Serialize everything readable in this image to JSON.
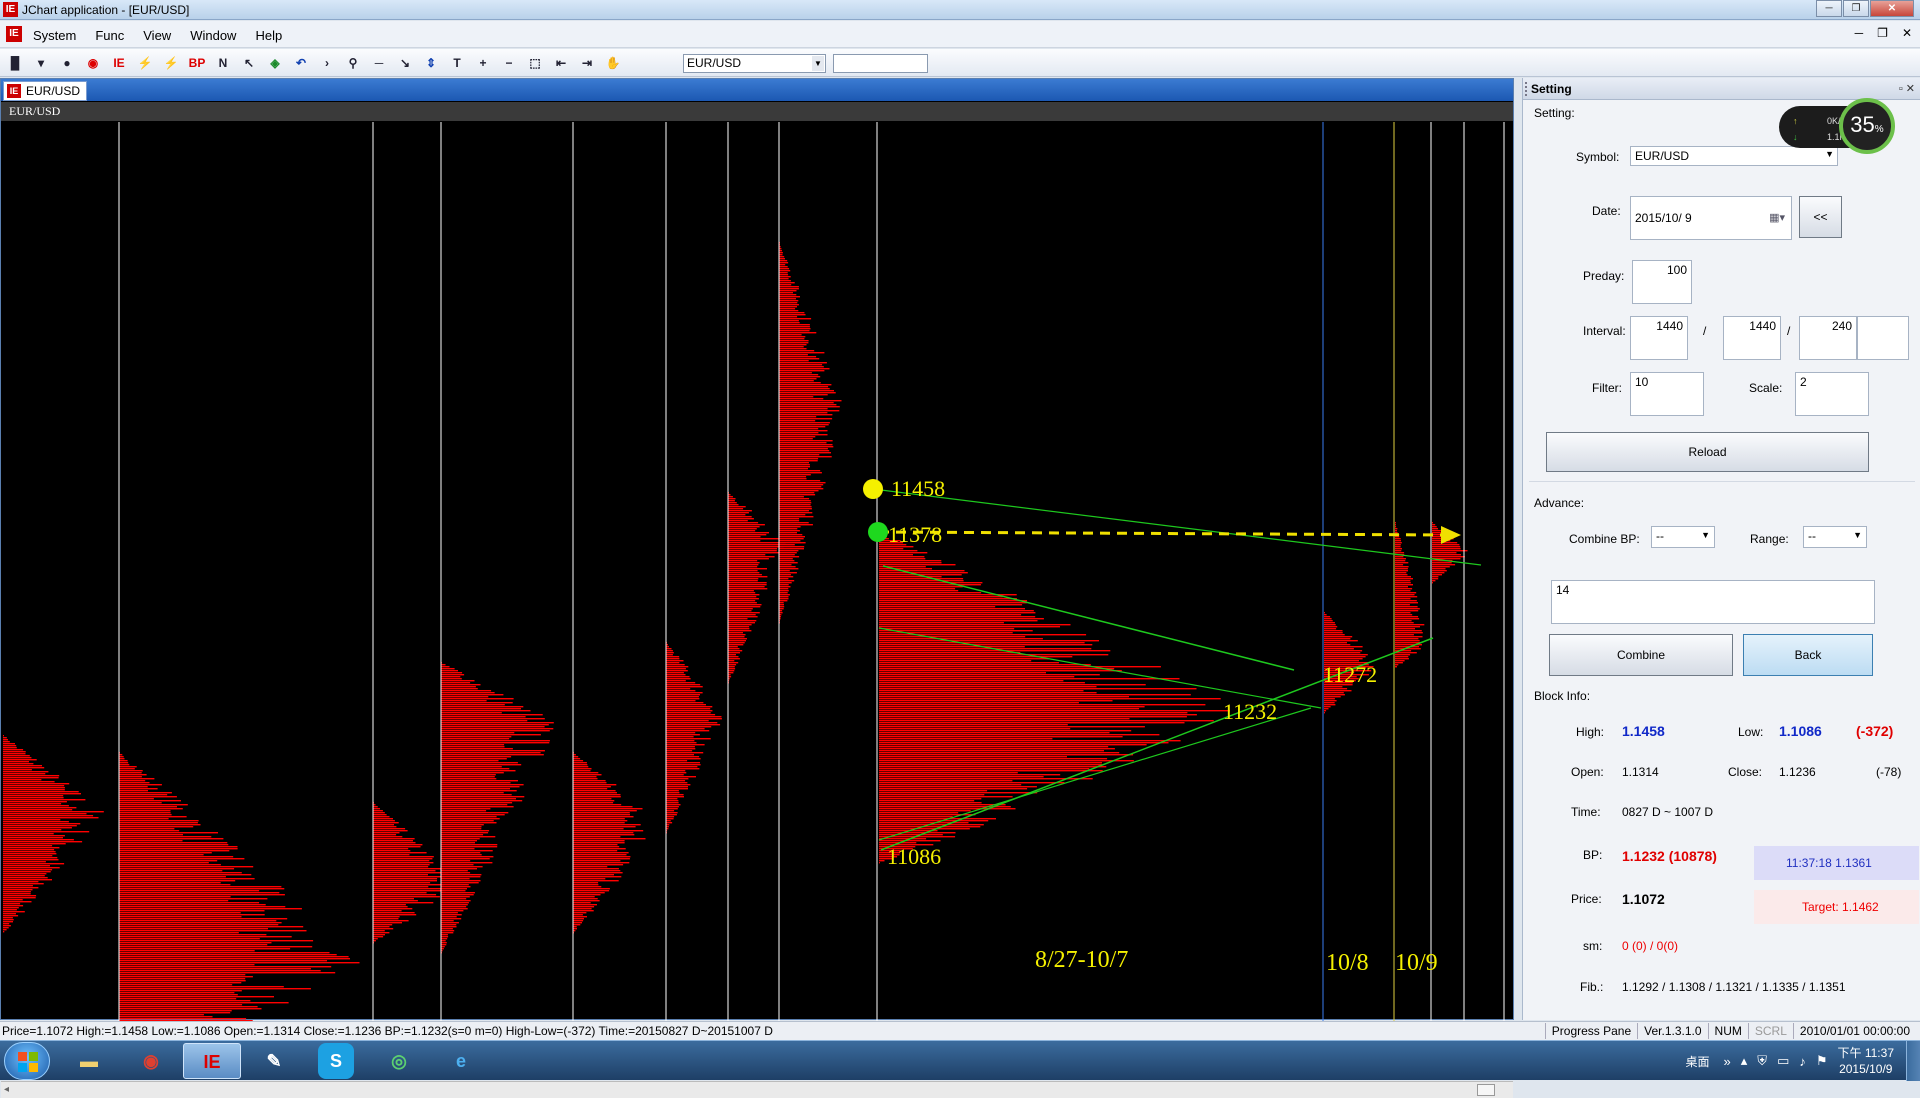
{
  "window": {
    "title": "JChart application - [EUR/USD]"
  },
  "menu": [
    "System",
    "Func",
    "View",
    "Window",
    "Help"
  ],
  "toolbar": {
    "symbol": "EUR/USD",
    "tools": [
      {
        "glyph": "▐▌",
        "name": "bar-chart-icon",
        "cls": ""
      },
      {
        "glyph": "▾",
        "name": "dropdown-arrow-icon",
        "cls": ""
      },
      {
        "glyph": "●",
        "name": "record-icon",
        "cls": ""
      },
      {
        "glyph": "◉",
        "name": "stop-icon",
        "cls": "red"
      },
      {
        "glyph": "IE",
        "name": "app-logo-icon",
        "cls": "red"
      },
      {
        "glyph": "⚡",
        "name": "lightning-yellow-icon",
        "cls": ""
      },
      {
        "glyph": "⚡",
        "name": "lightning-red-icon",
        "cls": "red"
      },
      {
        "glyph": "BP",
        "name": "bp-icon",
        "cls": "red"
      },
      {
        "glyph": "N",
        "name": "n-tool-icon",
        "cls": ""
      },
      {
        "glyph": "↖",
        "name": "pointer-icon",
        "cls": ""
      },
      {
        "glyph": "◈",
        "name": "layers-icon",
        "cls": "green"
      },
      {
        "glyph": "↶",
        "name": "undo-icon",
        "cls": "blue"
      },
      {
        "glyph": "›",
        "name": "next-icon",
        "cls": ""
      },
      {
        "glyph": "⚲",
        "name": "zoom-icon",
        "cls": ""
      },
      {
        "glyph": "─",
        "name": "horizontal-line-icon",
        "cls": ""
      },
      {
        "glyph": "↘",
        "name": "trend-line-icon",
        "cls": ""
      },
      {
        "glyph": "⇕",
        "name": "vertical-arrows-icon",
        "cls": "blue"
      },
      {
        "glyph": "T",
        "name": "text-tool-icon",
        "cls": ""
      },
      {
        "glyph": "+",
        "name": "zoom-in-icon",
        "cls": ""
      },
      {
        "glyph": "−",
        "name": "zoom-out-icon",
        "cls": ""
      },
      {
        "glyph": "⬚",
        "name": "select-rect-icon",
        "cls": ""
      },
      {
        "glyph": "⇤",
        "name": "scroll-left-icon",
        "cls": ""
      },
      {
        "glyph": "⇥",
        "name": "scroll-right-icon",
        "cls": ""
      },
      {
        "glyph": "✋",
        "name": "hand-icon",
        "cls": ""
      }
    ]
  },
  "chart": {
    "tab": "EUR/USD",
    "label": "EUR/USD",
    "annotations": {
      "high": "11458",
      "mid": "11378",
      "low": "11086",
      "bp": "11232",
      "bp2": "11272",
      "range_main": "8/27-10/7",
      "day1": "10/8",
      "day2": "10/9"
    },
    "colors": {
      "profile": "#ff0000",
      "annot": "#f5f000",
      "trend": "#1ec81e",
      "blueline": "#3a7cf0",
      "yellowline": "#e0d040"
    }
  },
  "panel": {
    "title": "Setting",
    "setting_label": "Setting:",
    "symbol_label": "Symbol:",
    "symbol_value": "EUR/USD",
    "date_label": "Date:",
    "date_value": "2015/10/  9",
    "back_btn": "<<",
    "preday_label": "Preday:",
    "preday_value": "100",
    "interval_label": "Interval:",
    "interval1": "1440",
    "interval2": "1440",
    "interval3": "240",
    "slash": "/",
    "filter_label": "Filter:",
    "filter_value": "10",
    "scale_label": "Scale:",
    "scale_value": "2",
    "reload": "Reload",
    "advance_label": "Advance:",
    "combine_bp_label": "Combine BP:",
    "combine_bp_value": "--",
    "range_label": "Range:",
    "range_value": "--",
    "text_value": "14",
    "combine": "Combine",
    "back": "Back",
    "block_info_label": "Block Info:",
    "high_label": "High:",
    "high_value": "1.1458",
    "low_label": "Low:",
    "low_value": "1.1086",
    "hl_diff": "(-372)",
    "open_label": "Open:",
    "open_value": "1.1314",
    "close_label": "Close:",
    "close_value": "1.1236",
    "oc_diff": "(-78)",
    "time_label": "Time:",
    "time_value": "0827 D ~ 1007 D",
    "bp_label": "BP:",
    "bp_value": "1.1232 (10878)",
    "quote_time": "11:37:18  1.1361",
    "price_label": "Price:",
    "price_value": "1.1072",
    "target": "Target: 1.1462",
    "sm_label": "sm:",
    "sm_value": "0 (0) / 0(0)",
    "fib_label": "Fib.:",
    "fib_value": "1.1292 / 1.1308 / 1.1321 / 1.1335 / 1.1351"
  },
  "speed": {
    "up": "0K/s",
    "down": "1.1K/s",
    "percent": "35",
    "unit": "%"
  },
  "status": {
    "left": "Price=1.1072  High:=1.1458  Low:=1.1086  Open:=1.1314  Close:=1.1236  BP:=1.1232(s=0 m=0)  High-Low=(-372)  Time:=20150827 D~20151007 D",
    "pane": "Progress Pane",
    "version": "Ver.1.3.1.0",
    "num": "NUM",
    "scrl": "SCRL",
    "datetime": "2010/01/01 00:00:00"
  },
  "taskbar": {
    "desktop": "桌面",
    "time": "下午 11:37",
    "date": "2015/10/9"
  }
}
